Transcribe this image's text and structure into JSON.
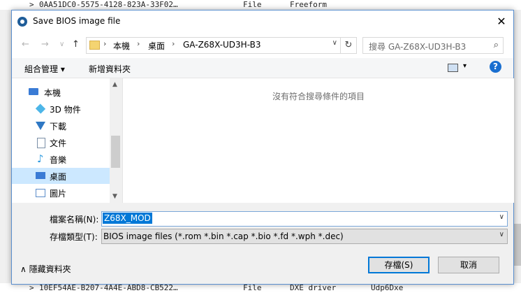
{
  "background": {
    "rows": [
      {
        "name": "0AA51DC0-5575-4128-823A-33F02…",
        "type": "File",
        "subtype": "Freeform",
        "extra": ""
      },
      {
        "name": "10EF54AE-B207-4A4E-ABD8-CB522…",
        "type": "File",
        "subtype": "DXE driver",
        "extra": "Udp6Dxe"
      }
    ],
    "chevron": ">"
  },
  "dialog": {
    "title": "Save BIOS image file",
    "close_glyph": "✕"
  },
  "nav": {
    "back_glyph": "←",
    "forward_glyph": "→",
    "dropdown_glyph": "∨",
    "up_glyph": "↑",
    "breadcrumb": [
      "本機",
      "桌面",
      "GA-Z68X-UD3H-B3"
    ],
    "sep_glyph": "›",
    "refresh_glyph": "↻",
    "search_placeholder": "搜尋 GA-Z68X-UD3H-B3",
    "search_glyph": "⌕"
  },
  "toolbar": {
    "organize": "組合管理 ▾",
    "new_folder": "新增資料夾",
    "view_dropdown": "▾",
    "help": "?"
  },
  "sidebar": {
    "items": [
      {
        "label": "本機",
        "icon": "computer-icon",
        "color": "#3a7bd5"
      },
      {
        "label": "3D 物件",
        "icon": "cube-icon",
        "color": "#4db6e8"
      },
      {
        "label": "下載",
        "icon": "download-icon",
        "color": "#2f78c4"
      },
      {
        "label": "文件",
        "icon": "document-icon",
        "color": "#7a8ea6"
      },
      {
        "label": "音樂",
        "icon": "music-icon",
        "color": "#2f9be0"
      },
      {
        "label": "桌面",
        "icon": "desktop-icon",
        "color": "#3a7bd5",
        "selected": true
      },
      {
        "label": "圖片",
        "icon": "pictures-icon",
        "color": "#5b8cc9"
      }
    ],
    "scroll_up": "▲",
    "scroll_down": "▼"
  },
  "filelist": {
    "empty_message": "沒有符合搜尋條件的項目"
  },
  "form": {
    "filename_label": "檔案名稱(N):",
    "filename_value": "Z68X_MOD",
    "filetype_label": "存檔類型(T):",
    "filetype_value": "BIOS image files (*.rom *.bin *.cap *.bio *.fd *.wph *.dec)",
    "dropdown_glyph": "∨"
  },
  "footer": {
    "hide_folders": "∧  隱藏資料夾",
    "save": "存檔(S)",
    "cancel": "取消"
  }
}
